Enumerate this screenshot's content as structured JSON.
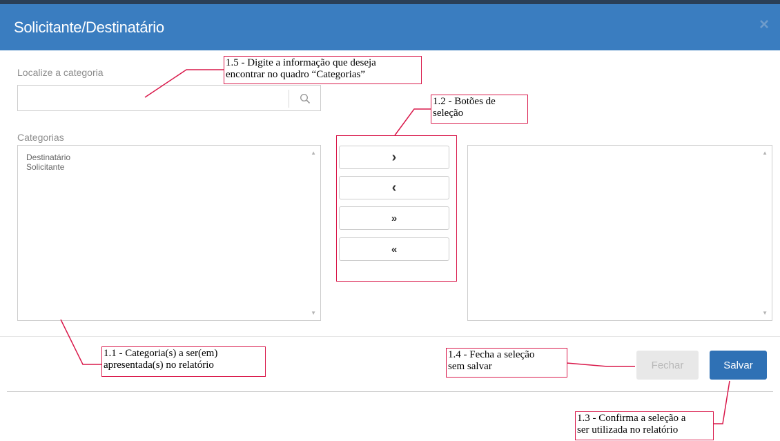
{
  "dialog": {
    "title": "Solicitante/Destinatário",
    "close_glyph": "×"
  },
  "search": {
    "label": "Localize a categoria",
    "value": "",
    "icon": "search-icon"
  },
  "categories": {
    "label": "Categorias",
    "items": [
      "Destinatário",
      "Solicitante"
    ]
  },
  "selected": {
    "items": []
  },
  "move_buttons": {
    "move_right": "›",
    "move_left": "‹",
    "move_all_right": "»",
    "move_all_left": "«"
  },
  "footer": {
    "close_label": "Fechar",
    "save_label": "Salvar"
  },
  "annotations": {
    "a15_line1": "1.5 - Digite a informação que deseja",
    "a15_line2": "encontrar no quadro “Categorias”",
    "a12_line1": "1.2 - Botões de",
    "a12_line2": "seleção",
    "a11_line1": "1.1 - Categoria(s) a ser(em)",
    "a11_line2": "apresentada(s) no relatório",
    "a14_line1": "1.4 - Fecha a seleção",
    "a14_line2": "sem salvar",
    "a13_line1": "1.3 - Confirma a seleção a",
    "a13_line2": "ser utilizada no relatório"
  },
  "colors": {
    "header": "#3a7dc0",
    "primary_button": "#2f71b5",
    "annotation_border": "#d9184a"
  }
}
